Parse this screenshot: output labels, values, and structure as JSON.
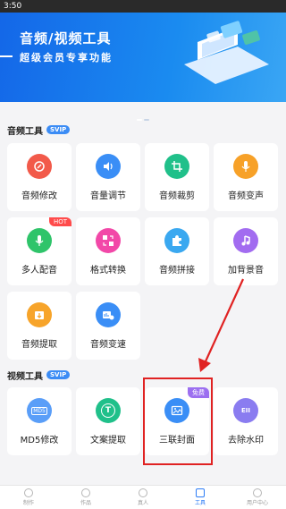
{
  "status_bar": {
    "time": "3:50"
  },
  "banner": {
    "title": "音频/视频工具",
    "subtitle": "超级会员专享功能"
  },
  "audio_section": {
    "title": "音频工具",
    "badge": "SVIP",
    "items": [
      {
        "label": "音频修改",
        "icon": "audio-edit-icon",
        "color": "#f25a4a"
      },
      {
        "label": "音量调节",
        "icon": "volume-icon",
        "color": "#3a8ef6"
      },
      {
        "label": "音频裁剪",
        "icon": "crop-icon",
        "color": "#20c08a"
      },
      {
        "label": "音频变声",
        "icon": "microphone-icon",
        "color": "#f7a128"
      },
      {
        "label": "多人配音",
        "icon": "mic-icon",
        "color": "#2fc46a",
        "badge": "HOT"
      },
      {
        "label": "格式转换",
        "icon": "convert-icon",
        "color": "#f248a8"
      },
      {
        "label": "音频拼接",
        "icon": "puzzle-icon",
        "color": "#3aa8f0"
      },
      {
        "label": "加背景音",
        "icon": "music-note-icon",
        "color": "#a26cf0"
      },
      {
        "label": "音频提取",
        "icon": "extract-icon",
        "color": "#f7a42a"
      },
      {
        "label": "音频变速",
        "icon": "speed-icon",
        "color": "#3a8ef6"
      }
    ]
  },
  "video_section": {
    "title": "视频工具",
    "badge": "SVIP",
    "items": [
      {
        "label": "MD5修改",
        "icon": "md5-icon",
        "color": "#5a9ef8",
        "icon_text": "MD5"
      },
      {
        "label": "文案提取",
        "icon": "text-extract-icon",
        "color": "#20c08a",
        "icon_text": "T"
      },
      {
        "label": "三联封面",
        "icon": "image-icon",
        "color": "#3a8ef6",
        "badge": "免费"
      },
      {
        "label": "去除水印",
        "icon": "watermark-icon",
        "color": "#8a7cf0",
        "icon_text": "EII"
      }
    ]
  },
  "tabbar": {
    "items": [
      {
        "label": "制作",
        "active": false
      },
      {
        "label": "作品",
        "active": false
      },
      {
        "label": "真人",
        "active": false
      },
      {
        "label": "工具",
        "active": true
      },
      {
        "label": "用户中心",
        "active": false
      }
    ]
  }
}
